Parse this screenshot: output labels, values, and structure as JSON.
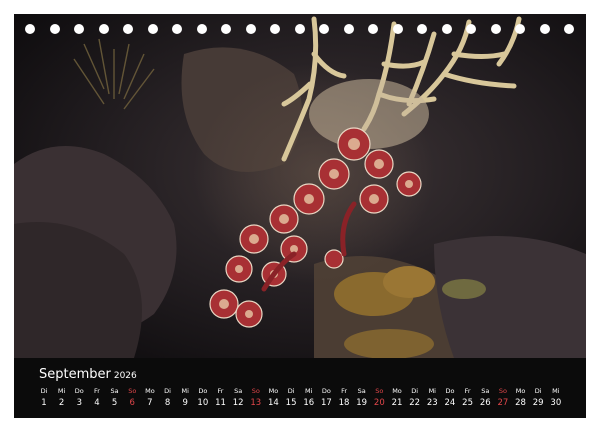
{
  "calendar": {
    "month": "September",
    "year": "2026",
    "days": [
      {
        "wd": "Di",
        "d": "1"
      },
      {
        "wd": "Mi",
        "d": "2"
      },
      {
        "wd": "Do",
        "d": "3"
      },
      {
        "wd": "Fr",
        "d": "4"
      },
      {
        "wd": "Sa",
        "d": "5"
      },
      {
        "wd": "So",
        "d": "6",
        "sunday": true
      },
      {
        "wd": "Mo",
        "d": "7"
      },
      {
        "wd": "Di",
        "d": "8"
      },
      {
        "wd": "Mi",
        "d": "9"
      },
      {
        "wd": "Do",
        "d": "10"
      },
      {
        "wd": "Fr",
        "d": "11"
      },
      {
        "wd": "Sa",
        "d": "12"
      },
      {
        "wd": "So",
        "d": "13",
        "sunday": true
      },
      {
        "wd": "Mo",
        "d": "14"
      },
      {
        "wd": "Di",
        "d": "15"
      },
      {
        "wd": "Mi",
        "d": "16"
      },
      {
        "wd": "Do",
        "d": "17"
      },
      {
        "wd": "Fr",
        "d": "18"
      },
      {
        "wd": "Sa",
        "d": "19"
      },
      {
        "wd": "So",
        "d": "20",
        "sunday": true
      },
      {
        "wd": "Mo",
        "d": "21"
      },
      {
        "wd": "Di",
        "d": "22"
      },
      {
        "wd": "Mi",
        "d": "23"
      },
      {
        "wd": "Do",
        "d": "24"
      },
      {
        "wd": "Fr",
        "d": "25"
      },
      {
        "wd": "Sa",
        "d": "26"
      },
      {
        "wd": "So",
        "d": "27",
        "sunday": true
      },
      {
        "wd": "Mo",
        "d": "28"
      },
      {
        "wd": "Di",
        "d": "29"
      },
      {
        "wd": "Mi",
        "d": "30"
      }
    ],
    "sunday_color": "#e0464a"
  },
  "binding_holes": 23
}
